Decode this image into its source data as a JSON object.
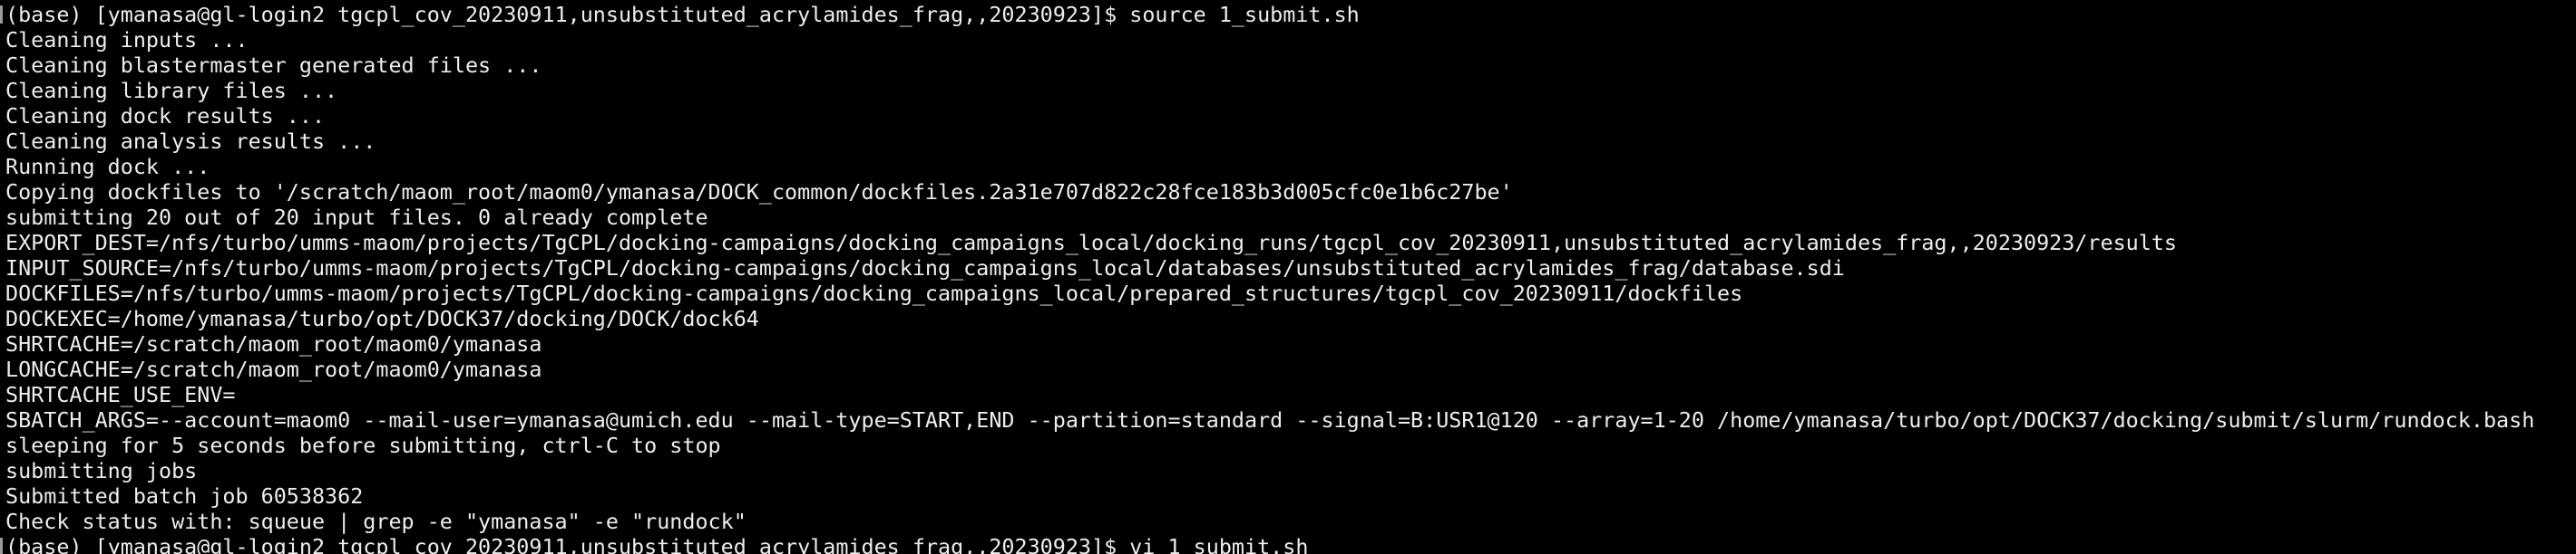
{
  "terminal": {
    "colors": {
      "background": "#000000",
      "foreground": "#ededed",
      "mark": "#9a9a9a"
    },
    "lines": [
      "(base) [ymanasa@gl-login2 tgcpl_cov_20230911,unsubstituted_acrylamides_frag,,20230923]$ source 1_submit.sh",
      "Cleaning inputs ...",
      "Cleaning blastermaster generated files ...",
      "Cleaning library files ...",
      "Cleaning dock results ...",
      "Cleaning analysis results ...",
      "Running dock ...",
      "Copying dockfiles to '/scratch/maom_root/maom0/ymanasa/DOCK_common/dockfiles.2a31e707d822c28fce183b3d005cfc0e1b6c27be'",
      "submitting 20 out of 20 input files. 0 already complete",
      "EXPORT_DEST=/nfs/turbo/umms-maom/projects/TgCPL/docking-campaigns/docking_campaigns_local/docking_runs/tgcpl_cov_20230911,unsubstituted_acrylamides_frag,,20230923/results",
      "INPUT_SOURCE=/nfs/turbo/umms-maom/projects/TgCPL/docking-campaigns/docking_campaigns_local/databases/unsubstituted_acrylamides_frag/database.sdi",
      "DOCKFILES=/nfs/turbo/umms-maom/projects/TgCPL/docking-campaigns/docking_campaigns_local/prepared_structures/tgcpl_cov_20230911/dockfiles",
      "DOCKEXEC=/home/ymanasa/turbo/opt/DOCK37/docking/DOCK/dock64",
      "SHRTCACHE=/scratch/maom_root/maom0/ymanasa",
      "LONGCACHE=/scratch/maom_root/maom0/ymanasa",
      "SHRTCACHE_USE_ENV=",
      "SBATCH_ARGS=--account=maom0 --mail-user=ymanasa@umich.edu --mail-type=START,END --partition=standard --signal=B:USR1@120 --array=1-20 /home/ymanasa/turbo/opt/DOCK37/docking/submit/slurm/rundock.bash",
      "sleeping for 5 seconds before submitting, ctrl-C to stop",
      "submitting jobs",
      "Submitted batch job 60538362",
      "Check status with: squeue | grep -e \"ymanasa\" -e \"rundock\"",
      "(base) [ymanasa@gl-login2 tgcpl_cov_20230911,unsubstituted_acrylamides_frag,,20230923]$ vi 1_submit.sh"
    ]
  }
}
